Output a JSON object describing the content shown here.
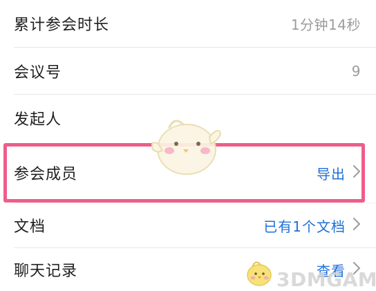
{
  "rows": [
    {
      "label": "累计参会时长",
      "value": "1分钟14秒"
    },
    {
      "label": "会议号",
      "value": "9"
    },
    {
      "label": "发起人",
      "value": ""
    },
    {
      "label": "参会成员",
      "action": "导出"
    },
    {
      "label": "文档",
      "action": "已有1个文档"
    },
    {
      "label": "聊天记录",
      "action": "查看"
    }
  ],
  "watermark": {
    "text": "3DMGAME"
  },
  "colors": {
    "accent_blue": "#1d6fd8",
    "highlight_pink": "#ef5d8a",
    "label_text": "#1f1f1f",
    "muted_text": "#9b9b9b"
  },
  "icons": [
    "chevron-right-icon",
    "mascot-bird-icon",
    "watermark-bird-icon"
  ]
}
